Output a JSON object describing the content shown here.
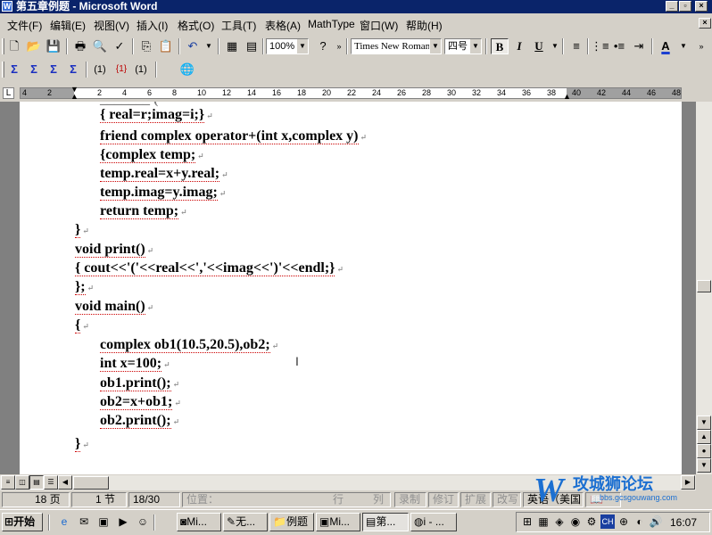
{
  "window": {
    "title": "第五章例题 - Microsoft Word",
    "app_icon": "word-doc-icon"
  },
  "menu": [
    "文件(F)",
    "编辑(E)",
    "视图(V)",
    "插入(I)",
    "格式(O)",
    "工具(T)",
    "表格(A)",
    "MathType",
    "窗口(W)",
    "帮助(H)"
  ],
  "standard_toolbar": {
    "zoom": "100%",
    "font_name": "Times New Roman",
    "font_size": "四号",
    "bold": "B",
    "italic": "I",
    "underline": "U",
    "font_color_label": "A"
  },
  "mathtype_toolbar": {
    "b1": "Σ",
    "b2": "Σ",
    "b3": "Σ",
    "b4": "Σ",
    "b5": "(1)",
    "b6": "{1}",
    "b7": "(1)"
  },
  "ruler": {
    "left_numbers": [
      "4",
      "2"
    ],
    "numbers": [
      "2",
      "4",
      "6",
      "8",
      "10",
      "12",
      "14",
      "16",
      "18",
      "20",
      "22",
      "24",
      "26",
      "28",
      "30",
      "32",
      "34",
      "36",
      "38",
      "40",
      "42",
      "44",
      "46",
      "48"
    ]
  },
  "document": {
    "lines": [
      {
        "text": "{ real=r;imag=i;}"
      },
      {
        "text": "friend complex operator+(int x,complex y)"
      },
      {
        "text": "{complex temp;"
      },
      {
        "text": "temp.real=x+y.real;"
      },
      {
        "text": "temp.imag=y.imag;"
      },
      {
        "text": "return temp;"
      },
      {
        "text": "}"
      },
      {
        "text": "void print()"
      },
      {
        "text": "{ cout<<'('<<real<<','<<imag<<')'<<endl;}"
      },
      {
        "text": "};"
      },
      {
        "text": "void main()"
      },
      {
        "text": "{"
      },
      {
        "text": "complex ob1(10.5,20.5),ob2;"
      },
      {
        "text": "int x=100;"
      },
      {
        "text": "ob1.print();"
      },
      {
        "text": "ob2=x+ob1;"
      },
      {
        "text": "ob2.print();"
      },
      {
        "text": "}"
      }
    ],
    "paragraph_mark": "↵"
  },
  "status": {
    "page": "18 页",
    "section": "1 节",
    "pages": "18/30",
    "position": "位置：",
    "line": "行",
    "column": "列",
    "rec": "录制",
    "trk": "修订",
    "ext": "扩展",
    "ovr": "改写",
    "language": "英语（美国"
  },
  "taskbar": {
    "start": "开始",
    "tasks": [
      "Mi...",
      "无...",
      "例题",
      "Mi...",
      "第...",
      "i - ..."
    ],
    "clock": "16:07"
  },
  "watermark": {
    "text": "攻城狮论坛",
    "subtext": "bbs.gcsgouwang.com"
  }
}
